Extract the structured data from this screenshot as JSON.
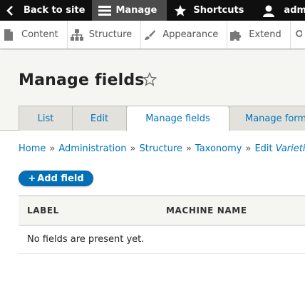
{
  "toolbar": {
    "back_label": "Back to site",
    "manage_label": "Manage",
    "shortcuts_label": "Shortcuts",
    "user_label": "admin"
  },
  "tray": {
    "items": [
      {
        "label": "Content",
        "icon": "file-icon"
      },
      {
        "label": "Structure",
        "icon": "sitemap-icon"
      },
      {
        "label": "Appearance",
        "icon": "brush-icon"
      },
      {
        "label": "Extend",
        "icon": "puzzle-icon"
      }
    ]
  },
  "page": {
    "title": "Manage fields"
  },
  "tabs": [
    {
      "label": "List",
      "active": false
    },
    {
      "label": "Edit",
      "active": false
    },
    {
      "label": "Manage fields",
      "active": true
    },
    {
      "label": "Manage form",
      "active": false
    }
  ],
  "breadcrumb": {
    "items": [
      "Home",
      "Administration",
      "Structure",
      "Taxonomy"
    ],
    "last_prefix": "Edit",
    "last_italic": "Varieties"
  },
  "actions": {
    "add_field_label": "Add field"
  },
  "table": {
    "headers": [
      "LABEL",
      "MACHINE NAME"
    ],
    "empty_message": "No fields are present yet."
  },
  "colors": {
    "toolbar_bg": "#0f0f0f",
    "link": "#0074bd",
    "primary_button": "#0071b8"
  }
}
